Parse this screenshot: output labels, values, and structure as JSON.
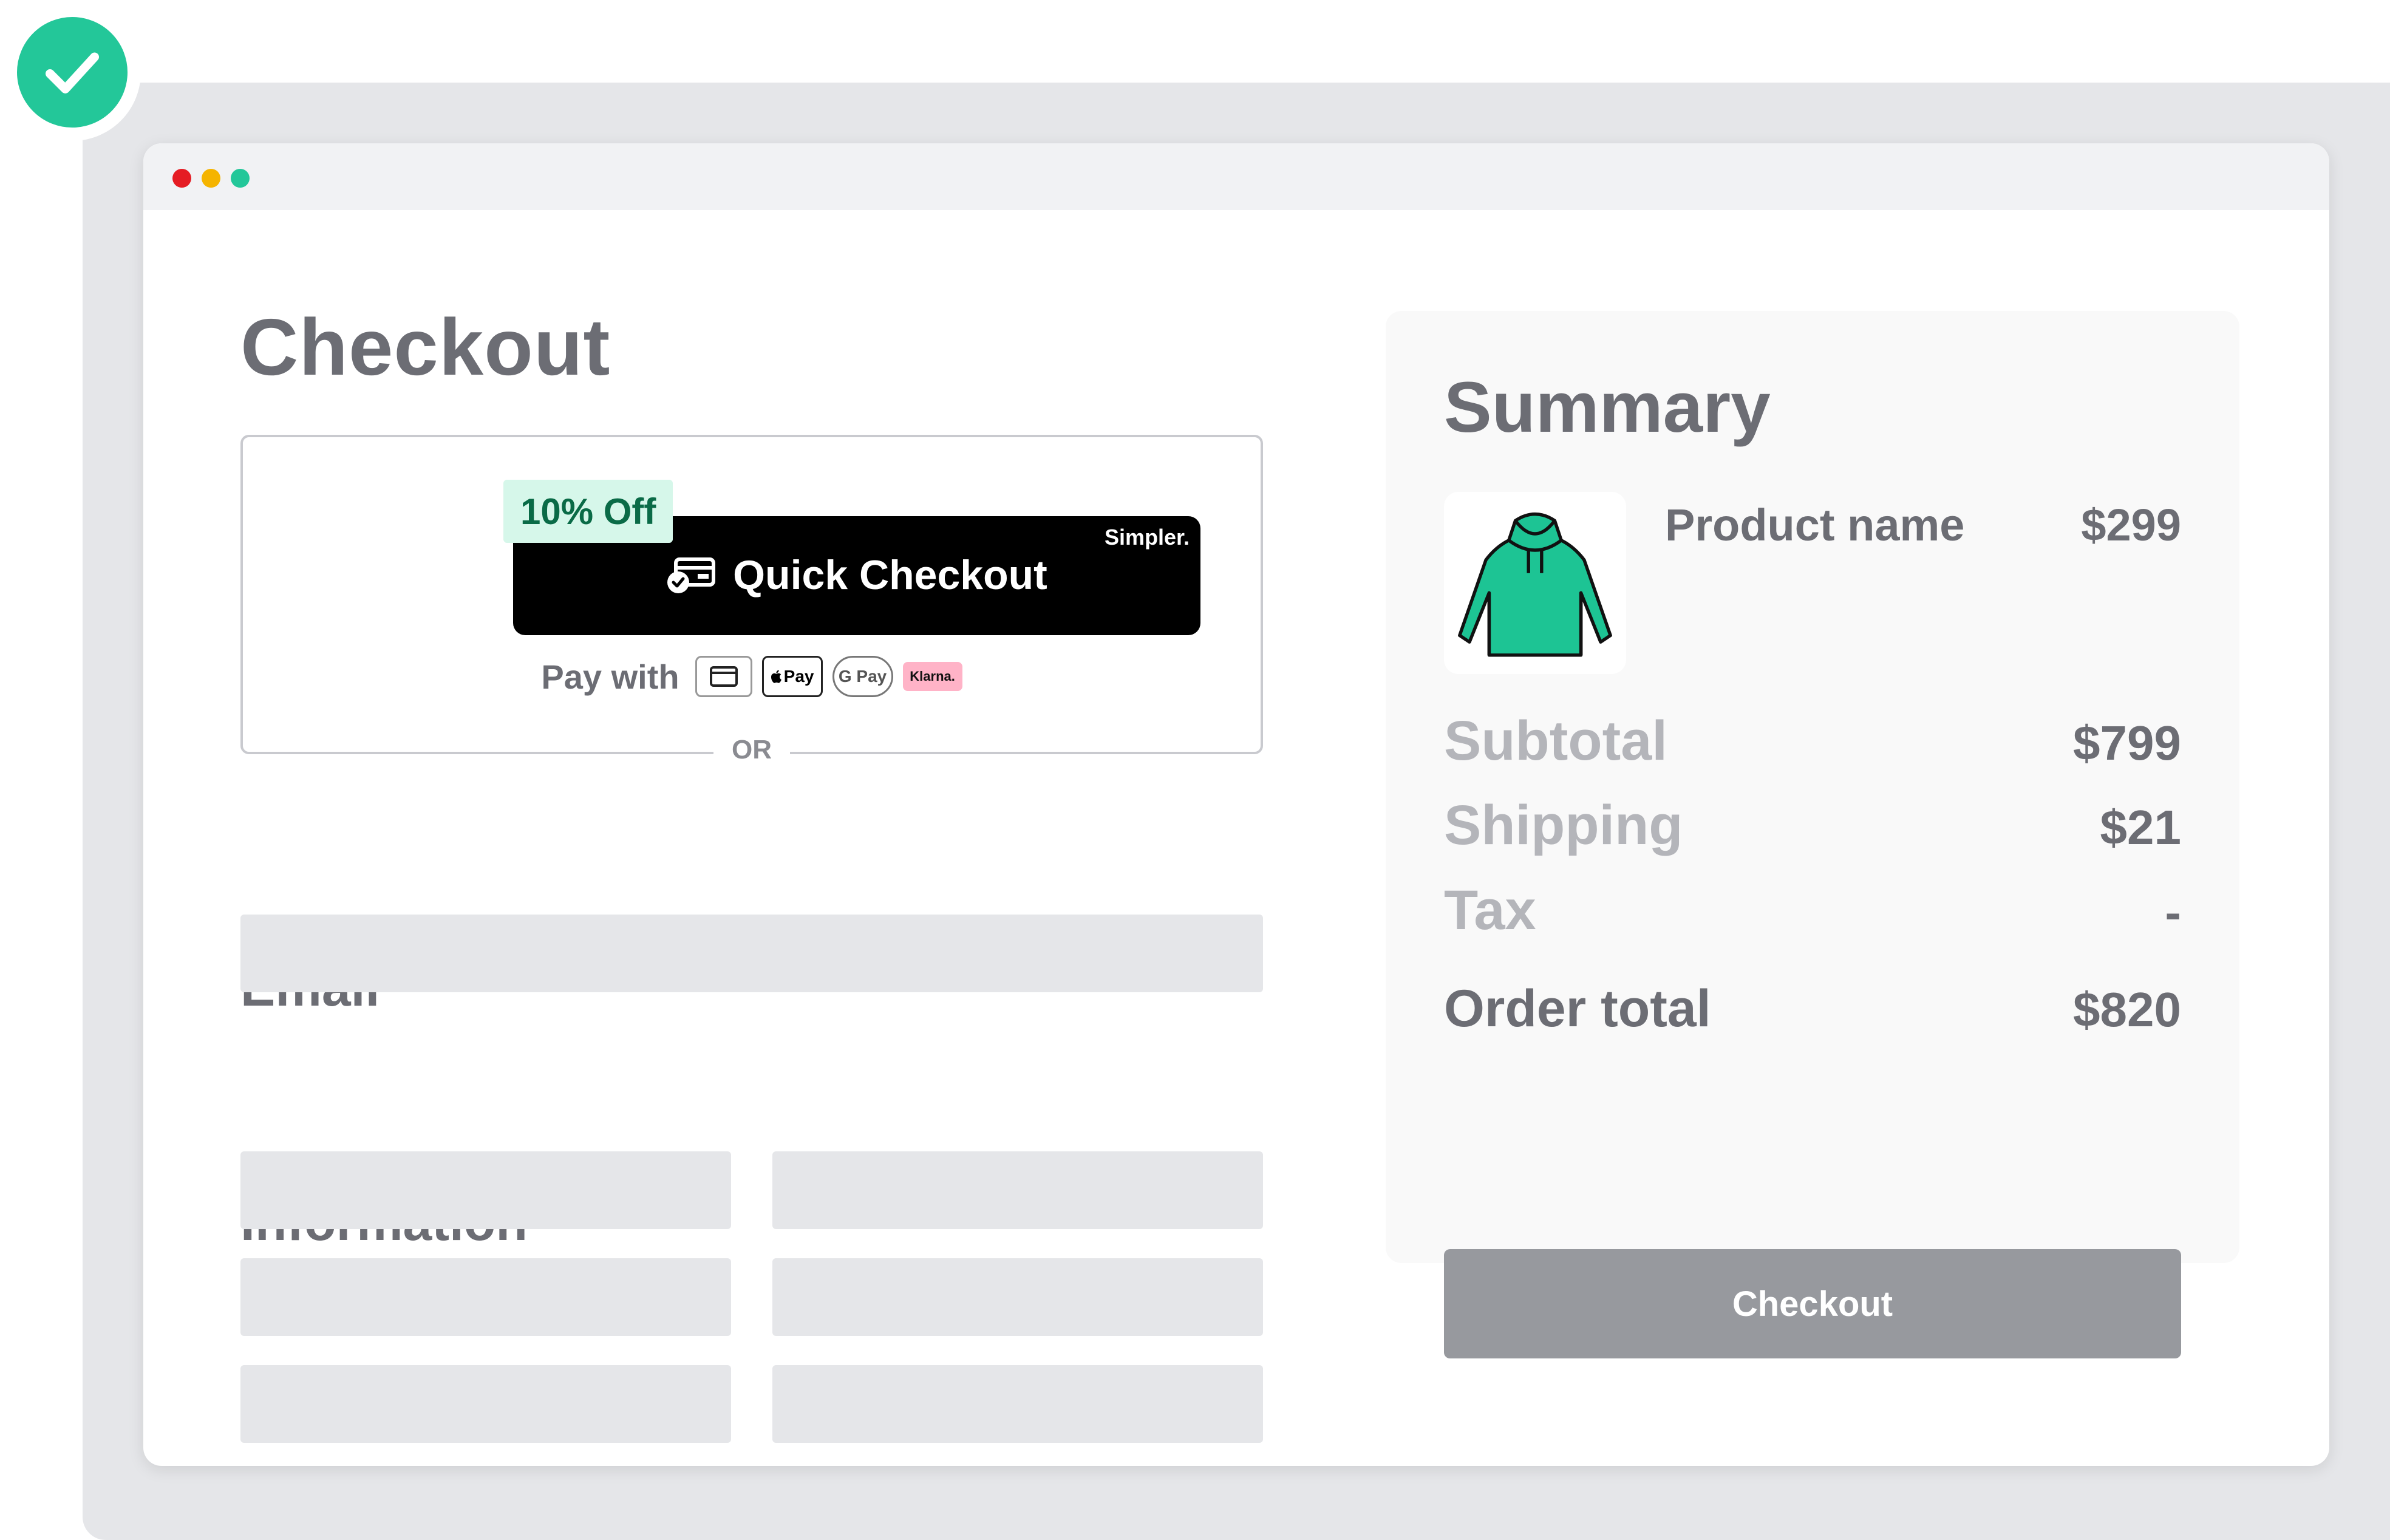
{
  "colors": {
    "accent": "#23c799",
    "text": "#6c6d74",
    "muted": "#b4b5ba",
    "dot_red": "#e51c23",
    "dot_yellow": "#f5b400",
    "dot_green": "#23c799"
  },
  "badge": {
    "icon": "checkmark-icon"
  },
  "checkout": {
    "title": "Checkout",
    "quick": {
      "discount": "10% Off",
      "brand": "Simpler.",
      "button_label": "Quick Checkout",
      "button_icon": "card-check-icon",
      "pay_with_label": "Pay with",
      "methods": [
        {
          "name": "card",
          "icon": "credit-card-icon"
        },
        {
          "name": "apple",
          "label": "Pay"
        },
        {
          "name": "gpay",
          "label": "G Pay"
        },
        {
          "name": "klarna",
          "label": "Klarna."
        }
      ]
    },
    "or_label": "OR",
    "email_title": "Email",
    "information_title": "Information"
  },
  "summary": {
    "title": "Summary",
    "product": {
      "name": "Product name",
      "price": "$299",
      "icon": "hoodie-icon"
    },
    "subtotal": {
      "label": "Subtotal",
      "value": "$799"
    },
    "shipping": {
      "label": "Shipping",
      "value": "$21"
    },
    "tax": {
      "label": "Tax",
      "value": "-"
    },
    "total": {
      "label": "Order total",
      "value": "$820"
    },
    "checkout_label": "Checkout"
  }
}
